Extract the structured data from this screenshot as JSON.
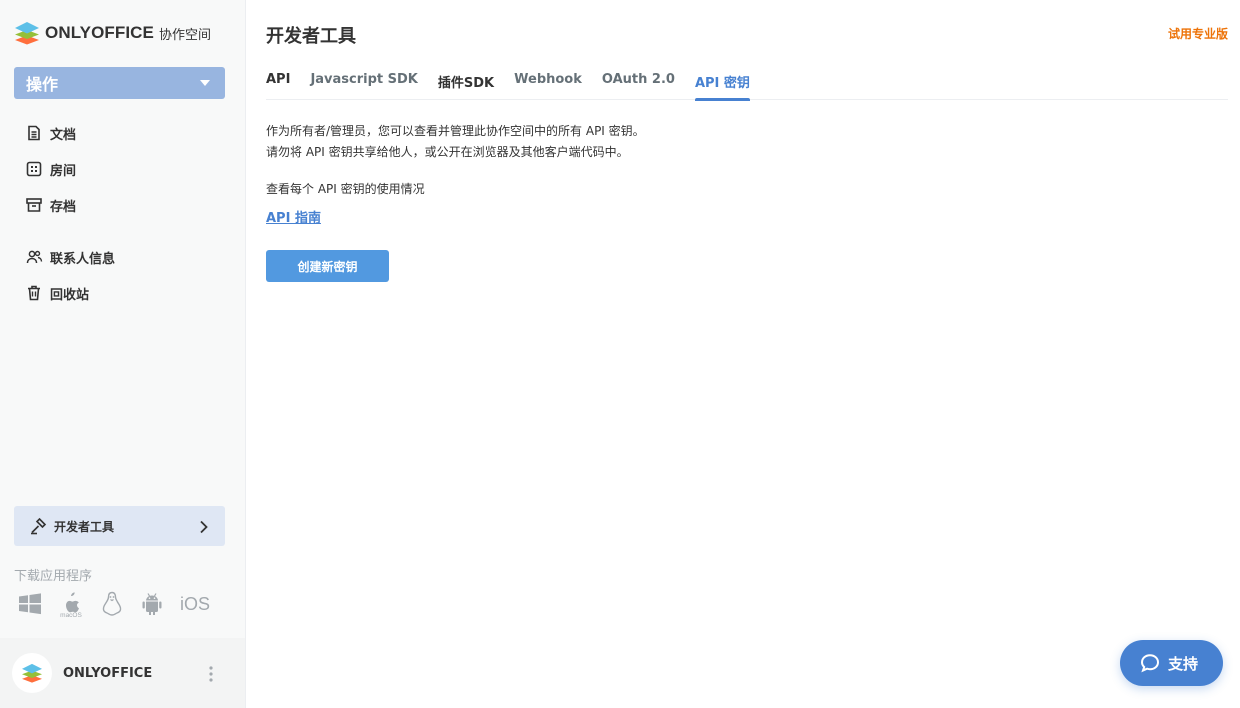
{
  "brand": {
    "name": "ONLYOFFICE",
    "product": "协作空间"
  },
  "sidebar": {
    "actions_label": "操作",
    "items": [
      {
        "label": "文档",
        "icon": "document-icon"
      },
      {
        "label": "房间",
        "icon": "rooms-icon"
      },
      {
        "label": "存档",
        "icon": "archive-icon"
      }
    ],
    "items2": [
      {
        "label": "联系人信息",
        "icon": "contacts-icon"
      },
      {
        "label": "回收站",
        "icon": "trash-icon"
      }
    ],
    "dev_tools_label": "开发者工具",
    "download_title": "下载应用程序",
    "apps": [
      "windows",
      "macOS",
      "linux",
      "android",
      "iOS"
    ],
    "profile_name": "ONLYOFFICE"
  },
  "main": {
    "title": "开发者工具",
    "upgrade_label": "试用专业版",
    "tabs": [
      "API",
      "Javascript SDK",
      "插件SDK",
      "Webhook",
      "OAuth 2.0",
      "API 密钥"
    ],
    "active_tab": "API 密钥",
    "description_line1": "作为所有者/管理员，您可以查看并管理此协作空间中的所有 API 密钥。",
    "description_line2": "请勿将 API 密钥共享给他人，或公开在浏览器及其他客户端代码中。",
    "usage_text": "查看每个 API 密钥的使用情况",
    "guide_link": "API 指南",
    "create_button": "创建新密钥"
  },
  "support": {
    "label": "支持"
  },
  "colors": {
    "accent": "#4781d1",
    "button": "#5299e0",
    "upgrade": "#ed7309",
    "actions": "#98b5e0"
  }
}
